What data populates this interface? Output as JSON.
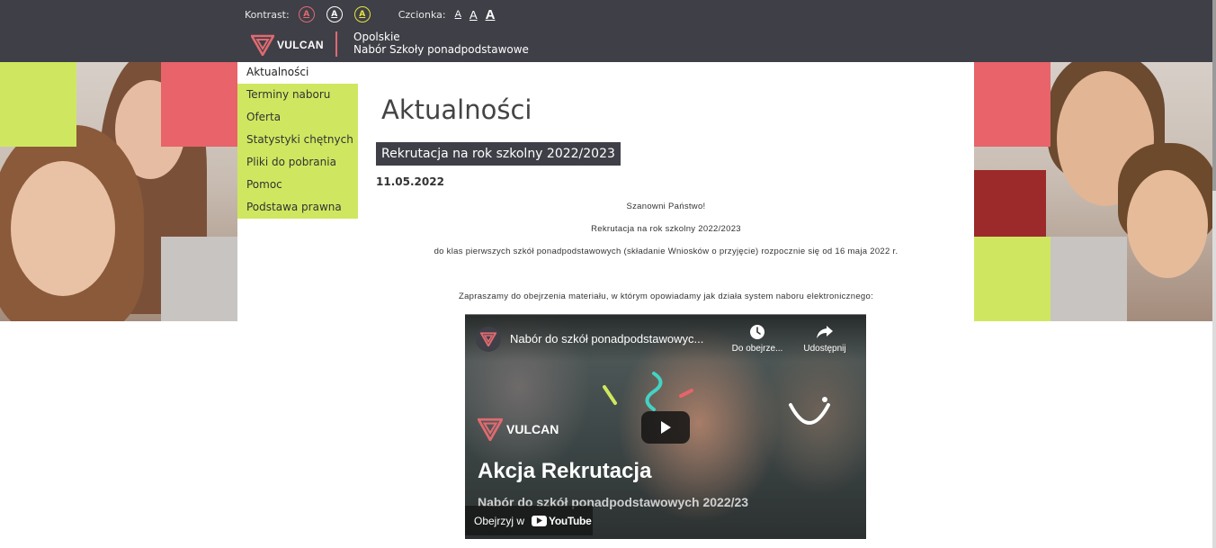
{
  "accessibility": {
    "contrast_label": "Kontrast:",
    "contrast_options": [
      "A",
      "A",
      "A"
    ],
    "font_label": "Czcionka:",
    "font_sizes": [
      "A",
      "A",
      "A"
    ]
  },
  "brand": {
    "logo_text": "VULCAN",
    "region": "Opolskie",
    "system": "Nabór Szkoły ponadpodstawowe",
    "accent_color": "#e06a70"
  },
  "sidebar": {
    "items": [
      {
        "label": "Aktualności",
        "active": true
      },
      {
        "label": "Terminy naboru"
      },
      {
        "label": "Oferta"
      },
      {
        "label": "Statystyki chętnych"
      },
      {
        "label": "Pliki do pobrania"
      },
      {
        "label": "Pomoc"
      },
      {
        "label": "Podstawa prawna"
      }
    ],
    "menu_color": "#cfe760"
  },
  "main": {
    "title": "Aktualności",
    "article": {
      "header": "Rekrutacja na rok szkolny 2022/2023",
      "date": "11.05.2022",
      "paragraphs": [
        "Szanowni Państwo!",
        "Rekrutacja na rok szkolny 2022/2023",
        "do klas pierwszych szkół ponadpodstawowych (składanie Wniosków o przyjęcie) rozpocznie się od 16 maja 2022 r.",
        "Zapraszamy do obejrzenia materiału, w którym opowiadamy jak działa system naboru elektronicznego:"
      ]
    },
    "video": {
      "title": "Nabór do szkół ponadpodstawowyc...",
      "watch_later": "Do obejrze...",
      "share": "Udostępnij",
      "logo_text": "VULCAN",
      "headline": "Akcja Rekrutacja",
      "subheadline": "Nabór do szkół ponadpodstawowych 2022/23",
      "watch_on": "Obejrzyj w",
      "youtube": "YouTube"
    }
  }
}
